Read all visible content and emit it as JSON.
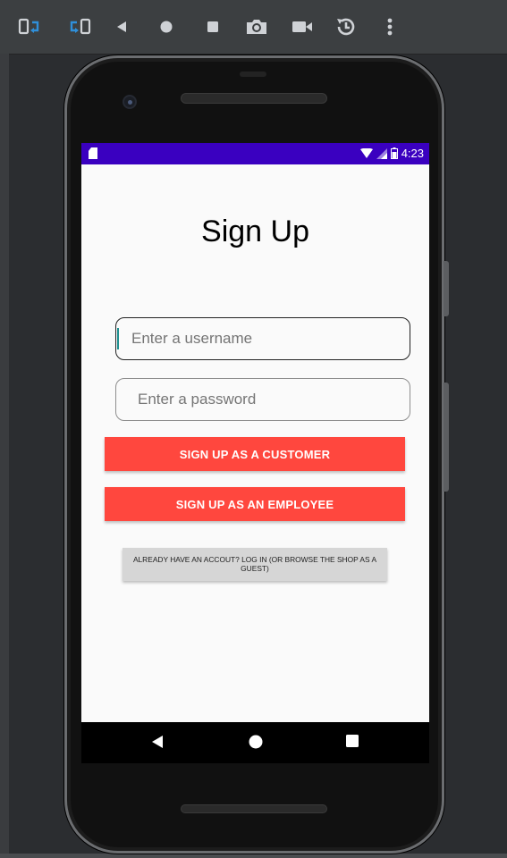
{
  "toolbar": {
    "buttons": [
      "rotate-left-icon",
      "rotate-right-icon",
      "back-icon",
      "home-icon",
      "overview-icon",
      "camera-icon",
      "video-icon",
      "snapshot-icon",
      "more-icon"
    ]
  },
  "status_bar": {
    "time": "4:23",
    "color": "#3a00c0"
  },
  "screen": {
    "title": "Sign Up",
    "username_placeholder": "Enter a username",
    "password_placeholder": "Enter a password",
    "customer_button": "SIGN UP AS A CUSTOMER",
    "employee_button": "SIGN UP AS AN EMPLOYEE",
    "login_button": "ALREADY HAVE AN ACCOUT? LOG IN (OR BROWSE THE SHOP AS A GUEST)",
    "accent": "#ff473e"
  }
}
